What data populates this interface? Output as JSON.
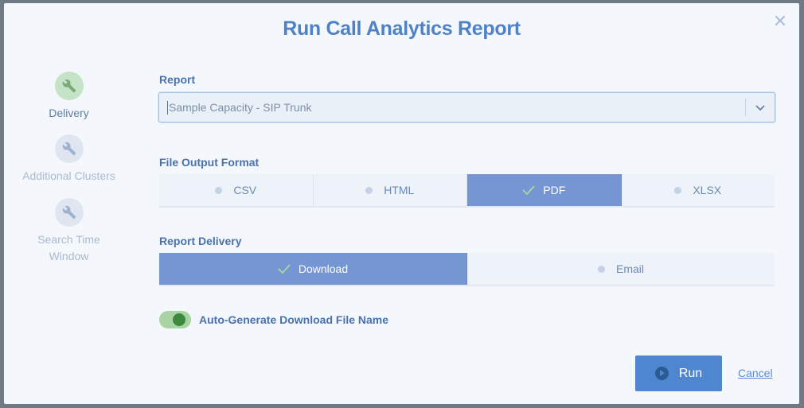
{
  "dialog": {
    "title": "Run Call Analytics Report",
    "close_icon": "close-icon"
  },
  "steps": [
    {
      "label": "Delivery",
      "icon": "wrench-icon",
      "active": true
    },
    {
      "label": "Additional Clusters",
      "icon": "wrench-icon",
      "active": false
    },
    {
      "label": "Search Time Window",
      "icon": "wrench-icon",
      "active": false
    }
  ],
  "report": {
    "label": "Report",
    "selected": "Sample Capacity - SIP Trunk",
    "dropdown_icon": "chevron-down-icon"
  },
  "file_output": {
    "label": "File Output Format",
    "options": [
      "CSV",
      "HTML",
      "PDF",
      "XLSX"
    ],
    "selected": "PDF"
  },
  "delivery": {
    "label": "Report Delivery",
    "options": [
      "Download",
      "Email"
    ],
    "selected": "Download"
  },
  "auto_filename": {
    "label": "Auto-Generate Download File Name",
    "enabled": true
  },
  "actions": {
    "run_label": "Run",
    "cancel_label": "Cancel"
  },
  "colors": {
    "accent": "#4e86cf",
    "selected_segment": "#7595d3",
    "title": "#4f81c7",
    "toggle_on": "#3c8a3d"
  }
}
